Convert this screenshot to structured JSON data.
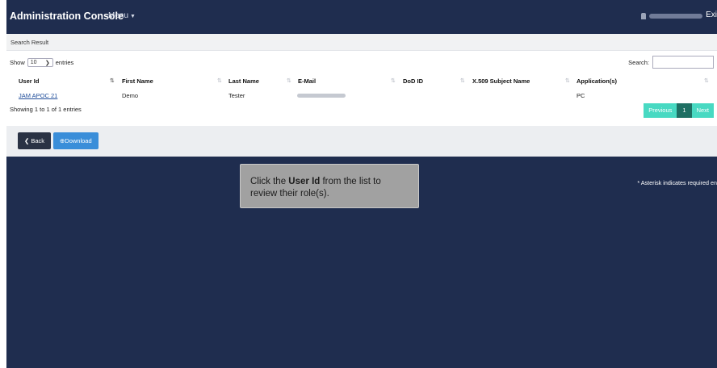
{
  "header": {
    "app_title": "Administration Console",
    "menu_label": "Menu",
    "exit_label": "Exi"
  },
  "panel": {
    "heading": "Search Result",
    "show_label": "Show",
    "page_length": "10",
    "entries_label": "entries",
    "search_label": "Search:",
    "search_value": ""
  },
  "table": {
    "columns": [
      "User Id",
      "First Name",
      "Last Name",
      "E-Mail",
      "DoD ID",
      "X.509 Subject Name",
      "Application(s)"
    ],
    "rows": [
      {
        "user_id": "JAM APOC 21",
        "first_name": "Demo",
        "last_name": "Tester",
        "email": "",
        "dod_id": "",
        "x509": "",
        "applications": "PC"
      }
    ],
    "info": "Showing 1 to 1 of 1 entries"
  },
  "pagination": {
    "previous": "Previous",
    "current": "1",
    "next": "Next"
  },
  "actions": {
    "back": "Back",
    "download": "Download"
  },
  "note": "* Asterisk indicates required en",
  "tooltip": {
    "pre": "Click the ",
    "bold": "User Id",
    "post": " from the list to review their role(s)."
  },
  "colors": {
    "background": "#1f2d4f",
    "pager_accent": "#48d9c2",
    "pager_current": "#1e6f63",
    "download_button": "#3a8ed9",
    "back_button": "#2a3244"
  }
}
